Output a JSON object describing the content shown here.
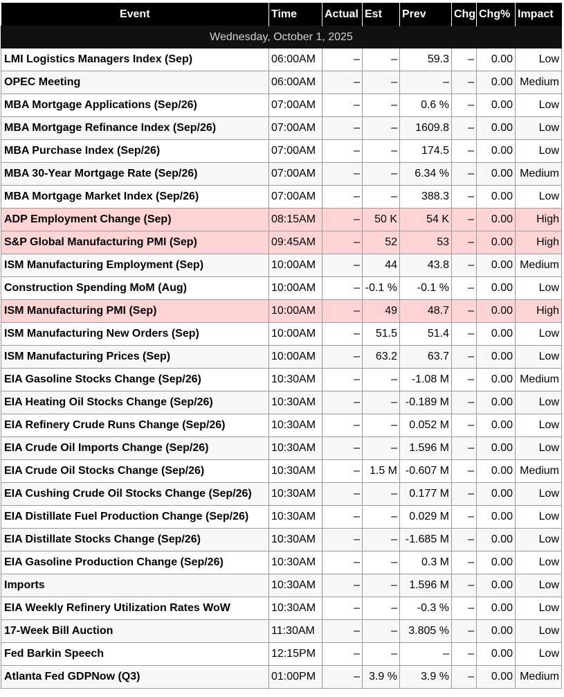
{
  "columns": [
    "Event",
    "Time",
    "Actual",
    "Est",
    "Prev",
    "Chg",
    "Chg%",
    "Impact"
  ],
  "date": "Wednesday, October 1, 2025",
  "colors": {
    "header_bg": "#000000",
    "high_impact_bg": "#ffd4d4",
    "border": "#9a9a9a"
  },
  "events": [
    {
      "event": "LMI Logistics Managers Index (Sep)",
      "time": "06:00AM",
      "actual": "–",
      "est": "–",
      "prev": "59.3",
      "chg": "–",
      "chg_pct": "0.00",
      "impact": "Low"
    },
    {
      "event": "OPEC Meeting",
      "time": "06:00AM",
      "actual": "–",
      "est": "–",
      "prev": "–",
      "chg": "–",
      "chg_pct": "0.00",
      "impact": "Medium"
    },
    {
      "event": "MBA Mortgage Applications (Sep/26)",
      "time": "07:00AM",
      "actual": "–",
      "est": "–",
      "prev": "0.6 %",
      "chg": "–",
      "chg_pct": "0.00",
      "impact": "Low"
    },
    {
      "event": "MBA Mortgage Refinance Index (Sep/26)",
      "time": "07:00AM",
      "actual": "–",
      "est": "–",
      "prev": "1609.8",
      "chg": "–",
      "chg_pct": "0.00",
      "impact": "Low"
    },
    {
      "event": "MBA Purchase Index (Sep/26)",
      "time": "07:00AM",
      "actual": "–",
      "est": "–",
      "prev": "174.5",
      "chg": "–",
      "chg_pct": "0.00",
      "impact": "Low"
    },
    {
      "event": "MBA 30-Year Mortgage Rate (Sep/26)",
      "time": "07:00AM",
      "actual": "–",
      "est": "–",
      "prev": "6.34 %",
      "chg": "–",
      "chg_pct": "0.00",
      "impact": "Medium"
    },
    {
      "event": "MBA Mortgage Market Index (Sep/26)",
      "time": "07:00AM",
      "actual": "–",
      "est": "–",
      "prev": "388.3",
      "chg": "–",
      "chg_pct": "0.00",
      "impact": "Low"
    },
    {
      "event": "ADP Employment Change (Sep)",
      "time": "08:15AM",
      "actual": "–",
      "est": "50 K",
      "prev": "54 K",
      "chg": "–",
      "chg_pct": "0.00",
      "impact": "High"
    },
    {
      "event": "S&P Global Manufacturing PMI (Sep)",
      "time": "09:45AM",
      "actual": "–",
      "est": "52",
      "prev": "53",
      "chg": "–",
      "chg_pct": "0.00",
      "impact": "High"
    },
    {
      "event": "ISM Manufacturing Employment (Sep)",
      "time": "10:00AM",
      "actual": "–",
      "est": "44",
      "prev": "43.8",
      "chg": "–",
      "chg_pct": "0.00",
      "impact": "Medium"
    },
    {
      "event": "Construction Spending MoM (Aug)",
      "time": "10:00AM",
      "actual": "–",
      "est": "-0.1 %",
      "prev": "-0.1 %",
      "chg": "–",
      "chg_pct": "0.00",
      "impact": "Low"
    },
    {
      "event": "ISM Manufacturing PMI (Sep)",
      "time": "10:00AM",
      "actual": "–",
      "est": "49",
      "prev": "48.7",
      "chg": "–",
      "chg_pct": "0.00",
      "impact": "High"
    },
    {
      "event": "ISM Manufacturing New Orders (Sep)",
      "time": "10:00AM",
      "actual": "–",
      "est": "51.5",
      "prev": "51.4",
      "chg": "–",
      "chg_pct": "0.00",
      "impact": "Low"
    },
    {
      "event": "ISM Manufacturing Prices (Sep)",
      "time": "10:00AM",
      "actual": "–",
      "est": "63.2",
      "prev": "63.7",
      "chg": "–",
      "chg_pct": "0.00",
      "impact": "Low"
    },
    {
      "event": "EIA Gasoline Stocks Change (Sep/26)",
      "time": "10:30AM",
      "actual": "–",
      "est": "–",
      "prev": "-1.08 M",
      "chg": "–",
      "chg_pct": "0.00",
      "impact": "Medium"
    },
    {
      "event": "EIA Heating Oil Stocks Change (Sep/26)",
      "time": "10:30AM",
      "actual": "–",
      "est": "–",
      "prev": "-0.189 M",
      "chg": "–",
      "chg_pct": "0.00",
      "impact": "Low"
    },
    {
      "event": "EIA Refinery Crude Runs Change (Sep/26)",
      "time": "10:30AM",
      "actual": "–",
      "est": "–",
      "prev": "0.052 M",
      "chg": "–",
      "chg_pct": "0.00",
      "impact": "Low"
    },
    {
      "event": "EIA Crude Oil Imports Change (Sep/26)",
      "time": "10:30AM",
      "actual": "–",
      "est": "–",
      "prev": "1.596 M",
      "chg": "–",
      "chg_pct": "0.00",
      "impact": "Low"
    },
    {
      "event": "EIA Crude Oil Stocks Change (Sep/26)",
      "time": "10:30AM",
      "actual": "–",
      "est": "1.5 M",
      "prev": "-0.607 M",
      "chg": "–",
      "chg_pct": "0.00",
      "impact": "Medium"
    },
    {
      "event": "EIA Cushing Crude Oil Stocks Change (Sep/26)",
      "time": "10:30AM",
      "actual": "–",
      "est": "–",
      "prev": "0.177 M",
      "chg": "–",
      "chg_pct": "0.00",
      "impact": "Low"
    },
    {
      "event": "EIA Distillate Fuel Production Change (Sep/26)",
      "time": "10:30AM",
      "actual": "–",
      "est": "–",
      "prev": "0.029 M",
      "chg": "–",
      "chg_pct": "0.00",
      "impact": "Low"
    },
    {
      "event": "EIA Distillate Stocks Change (Sep/26)",
      "time": "10:30AM",
      "actual": "–",
      "est": "–",
      "prev": "-1.685 M",
      "chg": "–",
      "chg_pct": "0.00",
      "impact": "Low"
    },
    {
      "event": "EIA Gasoline Production Change (Sep/26)",
      "time": "10:30AM",
      "actual": "–",
      "est": "–",
      "prev": "0.3 M",
      "chg": "–",
      "chg_pct": "0.00",
      "impact": "Low"
    },
    {
      "event": "Imports",
      "time": "10:30AM",
      "actual": "–",
      "est": "–",
      "prev": "1.596 M",
      "chg": "–",
      "chg_pct": "0.00",
      "impact": "Low"
    },
    {
      "event": "EIA Weekly Refinery Utilization Rates WoW",
      "time": "10:30AM",
      "actual": "–",
      "est": "–",
      "prev": "-0.3 %",
      "chg": "–",
      "chg_pct": "0.00",
      "impact": "Low"
    },
    {
      "event": "17-Week Bill Auction",
      "time": "11:30AM",
      "actual": "–",
      "est": "–",
      "prev": "3.805 %",
      "chg": "–",
      "chg_pct": "0.00",
      "impact": "Low"
    },
    {
      "event": "Fed Barkin Speech",
      "time": "12:15PM",
      "actual": "–",
      "est": "–",
      "prev": "–",
      "chg": "–",
      "chg_pct": "0.00",
      "impact": "Low"
    },
    {
      "event": "Atlanta Fed GDPNow (Q3)",
      "time": "01:00PM",
      "actual": "–",
      "est": "3.9 %",
      "prev": "3.9 %",
      "chg": "–",
      "chg_pct": "0.00",
      "impact": "Medium"
    }
  ]
}
